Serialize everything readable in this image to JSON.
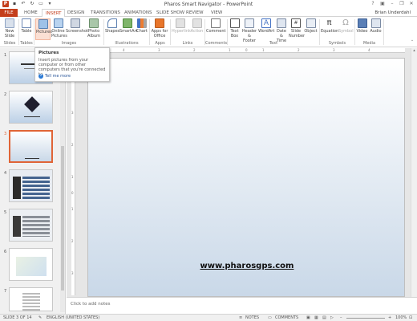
{
  "title": "Pharos Smart Navigator - PowerPoint",
  "user": "Brian Underdahl",
  "tabs": [
    "FILE",
    "HOME",
    "INSERT",
    "DESIGN",
    "TRANSITIONS",
    "ANIMATIONS",
    "SLIDE SHOW",
    "REVIEW",
    "VIEW"
  ],
  "ribbon": {
    "new_slide": "New Slide",
    "table": "Table",
    "pictures": "Pictures",
    "online_pictures": "Online Pictures",
    "screenshot": "Screenshot",
    "photo_album": "Photo Album",
    "shapes": "Shapes",
    "smartart": "SmartArt",
    "chart": "Chart",
    "apps_for_office": "Apps for Office",
    "hyperlink": "Hyperlink",
    "action": "Action",
    "comment": "Comment",
    "text_box": "Text Box",
    "header_footer": "Header & Footer",
    "wordart": "WordArt",
    "date_time": "Date & Time",
    "slide_number": "Slide Number",
    "object": "Object",
    "equation": "Equation",
    "symbol": "Symbol",
    "video": "Video",
    "audio": "Audio",
    "groups": [
      "Slides",
      "Tables",
      "Images",
      "Illustrations",
      "Apps",
      "Links",
      "Comments",
      "Text",
      "Symbols",
      "Media"
    ]
  },
  "tooltip": {
    "title": "Pictures",
    "description": "Insert pictures from your computer or from other computers that you're connected to.",
    "link": "Tell me more"
  },
  "thumbnails": [
    "1",
    "2",
    "3",
    "4",
    "5",
    "6",
    "7"
  ],
  "ruler_h": [
    "4",
    "3",
    "2",
    "1",
    "0",
    "1",
    "2",
    "3",
    "4"
  ],
  "ruler_v": [
    "3",
    "2",
    "1",
    "0",
    "1",
    "2",
    "3"
  ],
  "slide_url": "www.pharosgps.com",
  "notes_placeholder": "Click to add notes",
  "status": {
    "slide": "SLIDE 3 OF 14",
    "language": "ENGLISH (UNITED STATES)",
    "notes": "NOTES",
    "comments": "COMMENTS",
    "zoom": "100%"
  },
  "colors": {
    "accent": "#c43e1c",
    "selected_thumb_border": "#e06436"
  }
}
